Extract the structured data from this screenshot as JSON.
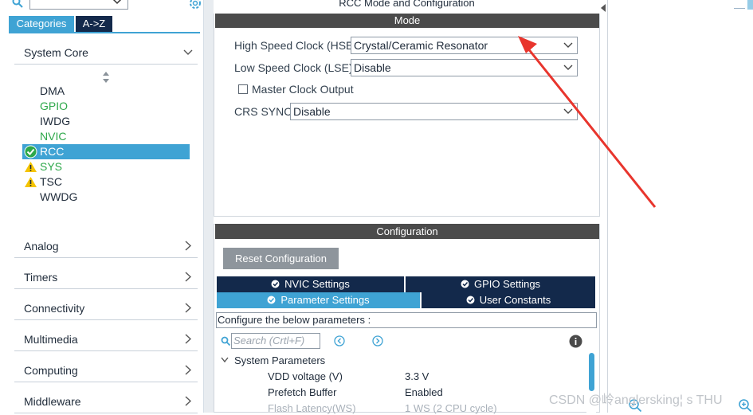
{
  "left": {
    "tabs": [
      "Categories",
      "A->Z"
    ],
    "system_core": {
      "label": "System Core",
      "items": [
        {
          "label": "DMA",
          "state": "normal"
        },
        {
          "label": "GPIO",
          "state": "green"
        },
        {
          "label": "IWDG",
          "state": "normal"
        },
        {
          "label": "NVIC",
          "state": "green"
        },
        {
          "label": "RCC",
          "state": "selected"
        },
        {
          "label": "SYS",
          "state": "warning"
        },
        {
          "label": "TSC",
          "state": "warning"
        },
        {
          "label": "WWDG",
          "state": "normal"
        }
      ]
    },
    "categories": [
      "Analog",
      "Timers",
      "Connectivity",
      "Multimedia",
      "Computing",
      "Middleware"
    ]
  },
  "mode": {
    "window_title": "RCC Mode and Configuration",
    "header": "Mode",
    "hse_label": "High Speed Clock (HSE)",
    "hse_value": "Crystal/Ceramic Resonator",
    "lse_label": "Low Speed Clock (LSE)",
    "lse_value": "Disable",
    "master_clock_label": "Master Clock Output",
    "master_clock_checked": false,
    "crs_label": "CRS SYNC",
    "crs_value": "Disable"
  },
  "config": {
    "header": "Configuration",
    "reset_label": "Reset Configuration",
    "tabs": [
      "NVIC Settings",
      "GPIO Settings",
      "Parameter Settings",
      "User Constants"
    ],
    "active_tab": "Parameter Settings",
    "configure_text": "Configure the below parameters :",
    "search_placeholder": "Search (Crtl+F)",
    "group_label": "System Parameters",
    "params": [
      {
        "name": "VDD voltage (V)",
        "value": "3.3 V"
      },
      {
        "name": "Prefetch Buffer",
        "value": "Enabled"
      },
      {
        "name": "Flash Latency(WS)",
        "value": "1 WS (2 CPU cycle)"
      }
    ]
  },
  "watermark": "CSDN @岭anglersking¦ s THU",
  "colors": {
    "accent": "#3fa3d4",
    "navy": "#13294b",
    "header_dark": "#4b4b4b",
    "status_green": "#2ea84a",
    "warning": "#f5c400",
    "annotation": "#e8352d"
  }
}
